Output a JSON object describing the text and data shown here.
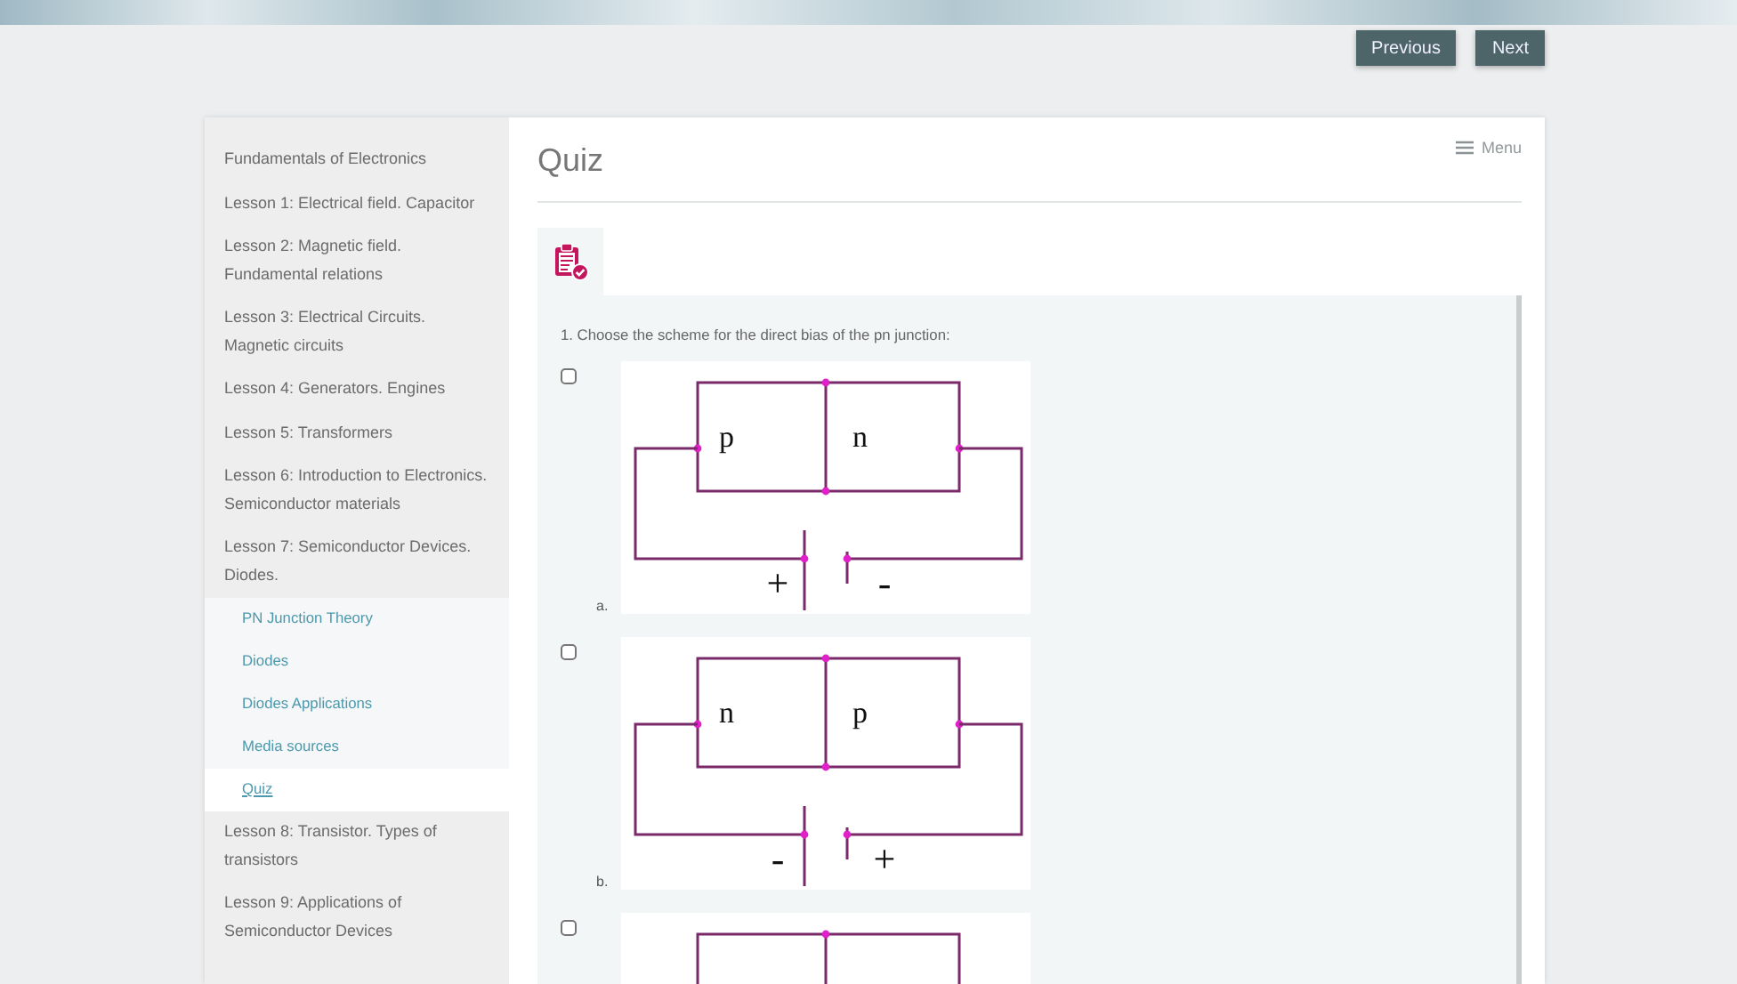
{
  "nav_buttons": [
    {
      "label": "Previous"
    },
    {
      "label": "Next"
    }
  ],
  "sidebar": {
    "items": [
      {
        "label": "Fundamentals of Electronics",
        "selected": false
      },
      {
        "label": "Lesson 1: Electrical field. Capacitor",
        "selected": false
      },
      {
        "label": "Lesson 2: Magnetic field. Fundamental relations",
        "selected": false
      },
      {
        "label": "Lesson 3: Electrical Circuits. Magnetic circuits",
        "selected": false
      },
      {
        "label": "Lesson 4: Generators. Engines",
        "selected": false
      },
      {
        "label": "Lesson 5: Transformers",
        "selected": false
      },
      {
        "label": "Lesson 6: Introduction to Electronics. Semiconductor materials",
        "selected": false
      },
      {
        "label": "Lesson 7: Semiconductor Devices. Diodes.",
        "selected": false,
        "children": [
          {
            "label": "PN Junction Theory",
            "selected": false
          },
          {
            "label": "Diodes",
            "selected": false
          },
          {
            "label": "Diodes Applications",
            "selected": false
          },
          {
            "label": "Media sources",
            "selected": false
          },
          {
            "label": "Quiz",
            "selected": true
          }
        ]
      },
      {
        "label": "Lesson 8: Transistor. Types of transistors",
        "selected": false
      },
      {
        "label": "Lesson 9: Applications of Semiconductor Devices",
        "selected": false
      }
    ]
  },
  "page_title": "Quiz",
  "menu_label": "Menu",
  "question": {
    "text": "1. Choose the scheme for the direct bias of the pn junction:",
    "options": [
      {
        "letter": "a.",
        "checked": false,
        "left_region": "p",
        "right_region": "n",
        "left_terminal": "+",
        "right_terminal": "-"
      },
      {
        "letter": "b.",
        "checked": false,
        "left_region": "n",
        "right_region": "p",
        "left_terminal": "-",
        "right_terminal": "+"
      },
      {
        "checked": false
      }
    ]
  }
}
